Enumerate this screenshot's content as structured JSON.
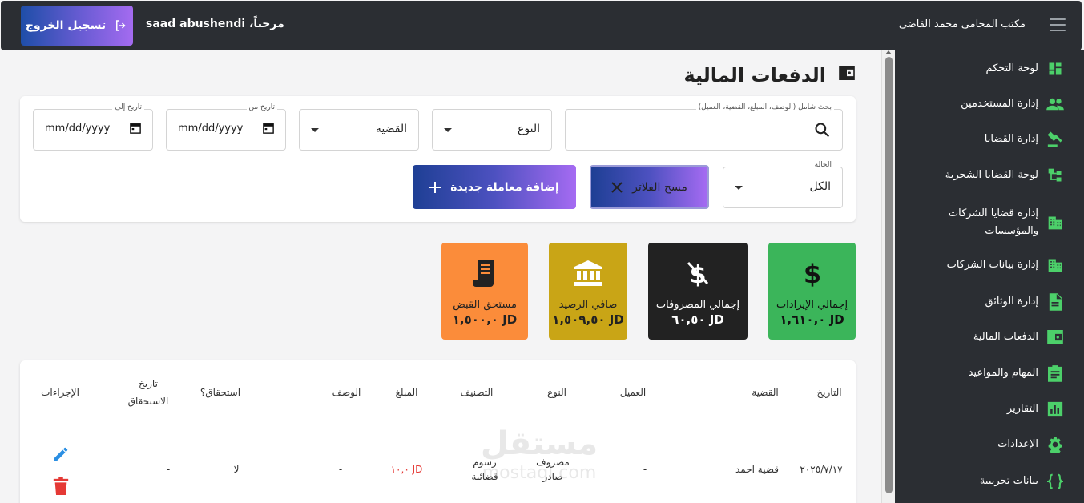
{
  "topbar": {
    "office_title": "مكتب المحامى محمد القاضى",
    "welcome": "مرحباً، saad abushendi",
    "logout_label": "تسجيل الخروج"
  },
  "sidebar": {
    "items": [
      {
        "label": "لوحة التحكم",
        "icon": "dashboard-icon"
      },
      {
        "label": "إدارة المستخدمين",
        "icon": "users-icon"
      },
      {
        "label": "إدارة القضايا",
        "icon": "gavel-icon"
      },
      {
        "label": "لوحة القضايا الشجرية",
        "icon": "tree-icon"
      },
      {
        "label": "إدارة قضايا الشركات والمؤسسات",
        "icon": "building-icon"
      },
      {
        "label": "إدارة بيانات الشركات",
        "icon": "building-icon"
      },
      {
        "label": "إدارة الوثائق",
        "icon": "document-icon"
      },
      {
        "label": "الدفعات المالية",
        "icon": "wallet-icon"
      },
      {
        "label": "المهام والمواعيد",
        "icon": "clipboard-icon"
      },
      {
        "label": "التقارير",
        "icon": "chart-icon"
      },
      {
        "label": "الإعدادات",
        "icon": "gear-icon"
      },
      {
        "label": "بيانات تجريبية",
        "icon": "braces-icon"
      }
    ]
  },
  "page": {
    "title": "الدفعات المالية"
  },
  "filters": {
    "search_label": "بحث شامل (الوصف، المبلغ، القضية، العميل)",
    "type_value": "النوع",
    "case_value": "القضية",
    "date_from_label": "تاريخ من",
    "date_from_value": "mm/dd/yyyy",
    "date_to_label": "تاريخ إلى",
    "date_to_value": "mm/dd/yyyy",
    "status_label": "الحالة",
    "status_value": "الكل",
    "clear_label": "مسح الفلاتر",
    "add_label": "إضافة معاملة جديدة"
  },
  "stats": [
    {
      "label": "إجمالي الإيرادات",
      "value": "JD ١,٦١٠,٠",
      "color": "#3bb55a",
      "icon": "dollar-icon"
    },
    {
      "label": "إجمالي المصروفات",
      "value": "JD ٦٠,٥٠",
      "color": "#222222",
      "icon": "no-money-icon"
    },
    {
      "label": "صافي الرصيد",
      "value": "JD ١,٥٠٩,٥٠",
      "color": "#c9a516",
      "icon": "bank-icon"
    },
    {
      "label": "مستحق القبض",
      "value": "JD ١,٥٠٠,٠",
      "color": "#fb8c3a",
      "icon": "receipt-icon"
    }
  ],
  "table": {
    "headers": [
      "التاريخ",
      "القضية",
      "العميل",
      "النوع",
      "التصنيف",
      "المبلغ",
      "الوصف",
      "استحقاق؟",
      "تاريخ الاستحقاق",
      "الإجراءات"
    ],
    "rows": [
      {
        "date": "٢٠٢٥/٧/١٧",
        "case": "قضية احمد",
        "client": "-",
        "type": "مصروف صادر",
        "category": "رسوم قضائية",
        "amount": "JD ١٠,٠",
        "description": "-",
        "due": "لا",
        "due_date": "-"
      }
    ]
  },
  "watermark": {
    "text_ar": "مستقل",
    "text_en": "mostaql.com"
  }
}
